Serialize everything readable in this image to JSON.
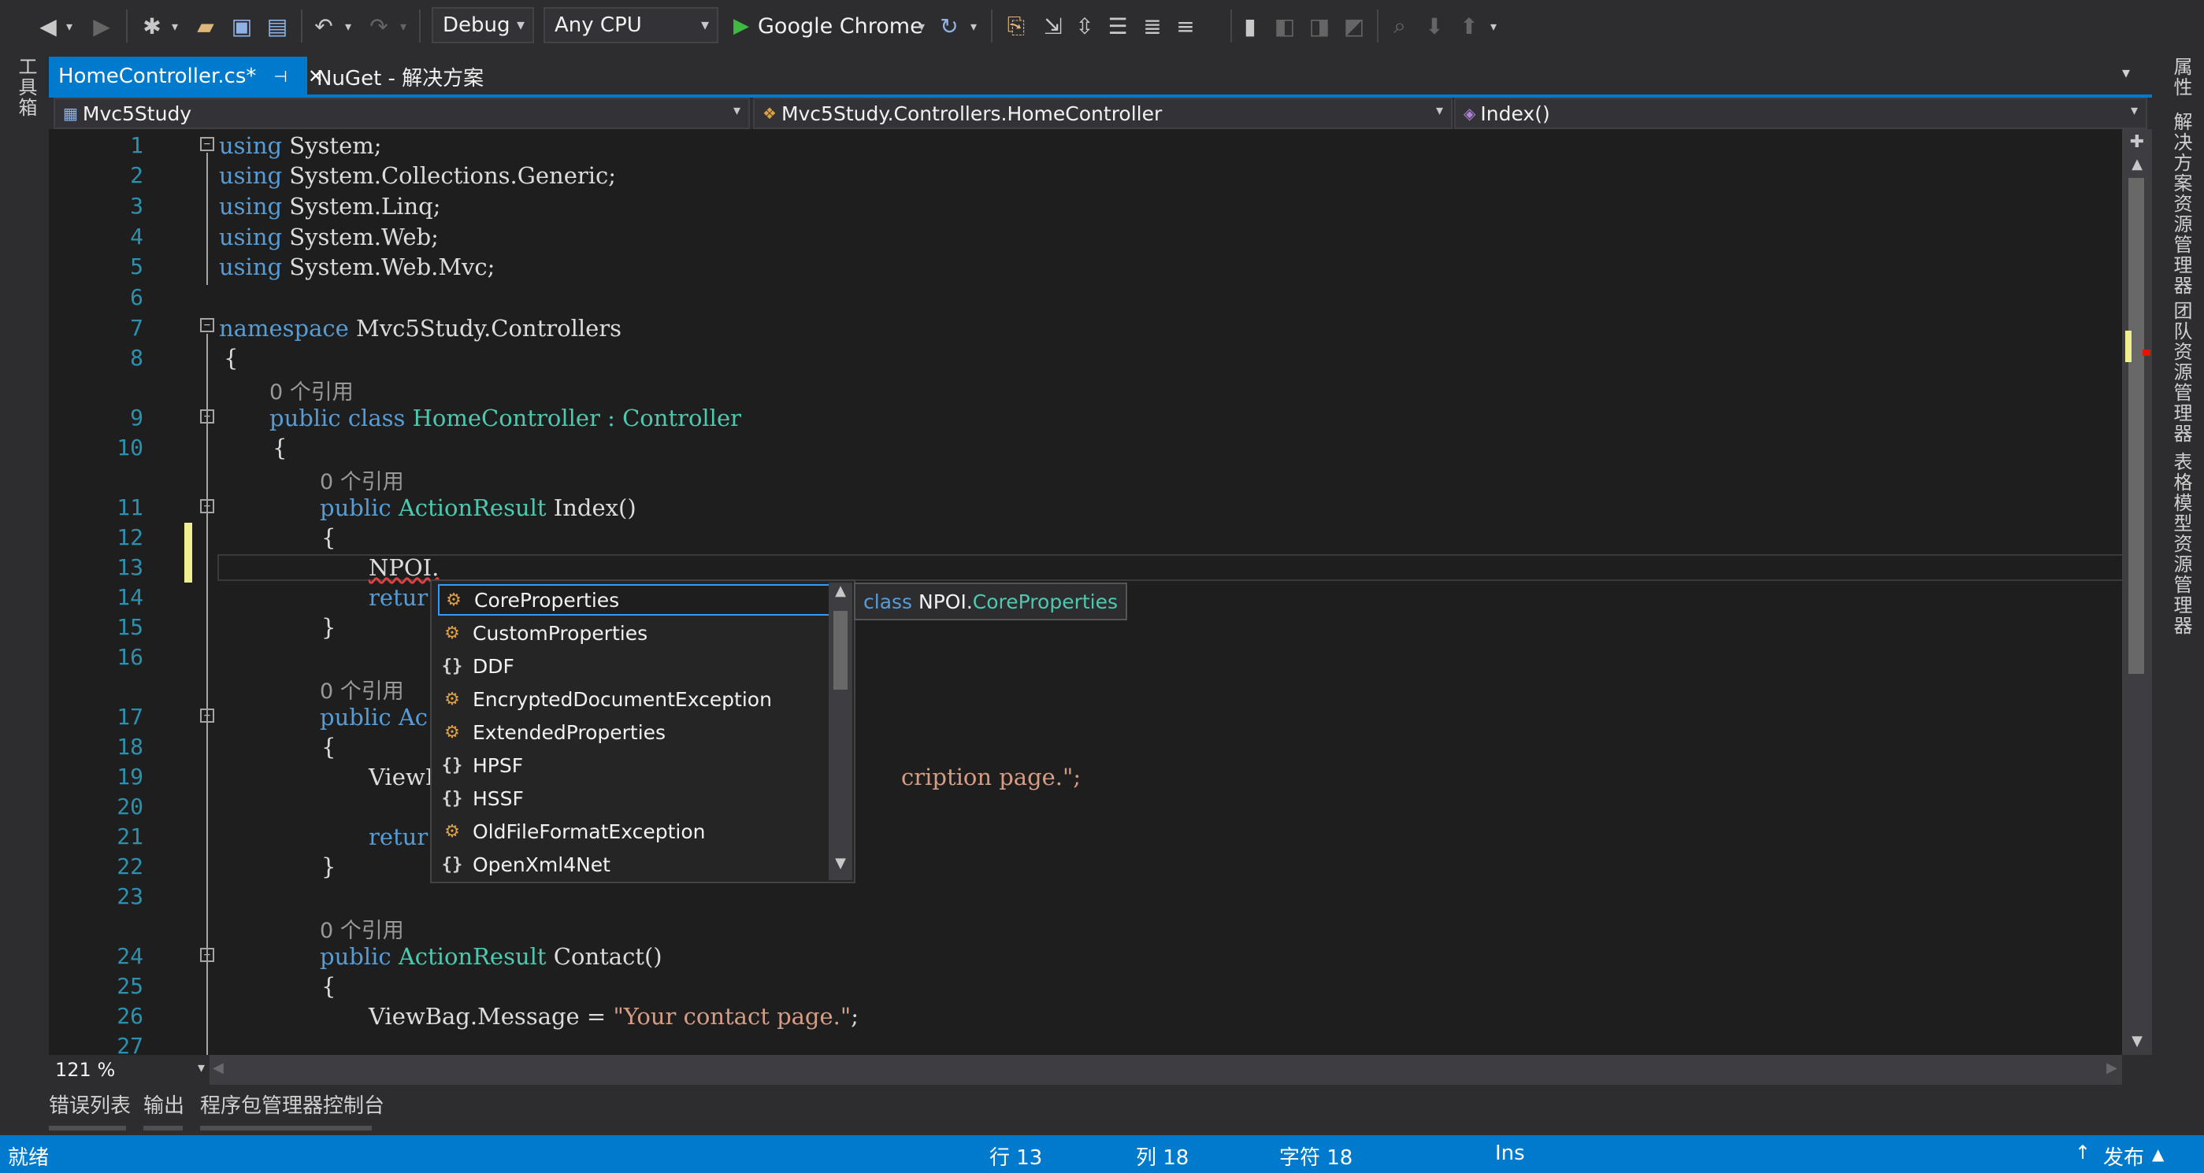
{
  "toolbar": {
    "config": "Debug",
    "platform": "Any CPU",
    "run_target": "Google Chrome"
  },
  "left_strip": {
    "toolbox": "工具箱"
  },
  "right_strip": {
    "properties": "属性",
    "solution_explorer": "解决方案资源管理器",
    "team_explorer": "团队资源管理器",
    "table_explorer": "表格模型资源管理器"
  },
  "tabs": [
    {
      "label": "HomeController.cs*",
      "pin": "⊣",
      "close": "✕"
    },
    {
      "label": "NuGet - 解决方案"
    }
  ],
  "nav": {
    "project": "Mvc5Study",
    "class": "Mvc5Study.Controllers.HomeController",
    "member": "Index()"
  },
  "line_numbers": [
    "1",
    "2",
    "3",
    "4",
    "5",
    "6",
    "7",
    "8",
    "9",
    "10",
    "11",
    "12",
    "13",
    "14",
    "15",
    "16",
    "17",
    "18",
    "19",
    "20",
    "21",
    "22",
    "23",
    "24",
    "25",
    "26",
    "27"
  ],
  "code": {
    "using_kw": "using",
    "l1": " System;",
    "l2": " System.Collections.Generic;",
    "l3": " System.Linq;",
    "l4": " System.Web;",
    "l5": " System.Web.Mvc;",
    "ns_kw": "namespace",
    "l7": " Mvc5Study.Controllers",
    "brace_open": "{",
    "brace_close": "}",
    "refs": "0 个引用",
    "public_class": "public class",
    "class_name": " HomeController : ",
    "base_type": "Controller",
    "public": "public",
    "action_result": " ActionResult",
    "index_sig": " Index()",
    "npoi": "NPOI.",
    "retur": "retur",
    "public_ac": "public Ac",
    "viewbag_b": "ViewB",
    "desc_tail": "cription page.\";",
    "contact_sig": " Contact()",
    "viewbag_msg": "ViewBag.Message = ",
    "contact_str": "\"Your contact page.\"",
    "semi": ";"
  },
  "completion": {
    "items": [
      {
        "label": "CoreProperties",
        "icon": "class-icon"
      },
      {
        "label": "CustomProperties",
        "icon": "class-icon"
      },
      {
        "label": "DDF",
        "icon": "namespace-icon"
      },
      {
        "label": "EncryptedDocumentException",
        "icon": "class-icon"
      },
      {
        "label": "ExtendedProperties",
        "icon": "class-icon"
      },
      {
        "label": "HPSF",
        "icon": "namespace-icon"
      },
      {
        "label": "HSSF",
        "icon": "namespace-icon"
      },
      {
        "label": "OldFileFormatException",
        "icon": "class-icon"
      },
      {
        "label": "OpenXml4Net",
        "icon": "namespace-icon"
      }
    ],
    "tooltip_kw": "class",
    "tooltip_ns": " NPOI.",
    "tooltip_type": "CoreProperties"
  },
  "zoom": "121 %",
  "bottom_tabs": [
    "错误列表",
    "输出",
    "程序包管理器控制台"
  ],
  "status": {
    "ready": "就绪",
    "line": "行 13",
    "col": "列 18",
    "char": "字符 18",
    "mode": "Ins",
    "publish": "发布"
  },
  "colors": {
    "accent": "#007acc",
    "editor_bg": "#1e1e1e",
    "keyword": "#569cd6",
    "type": "#4ec9b0",
    "string": "#d69d85"
  }
}
